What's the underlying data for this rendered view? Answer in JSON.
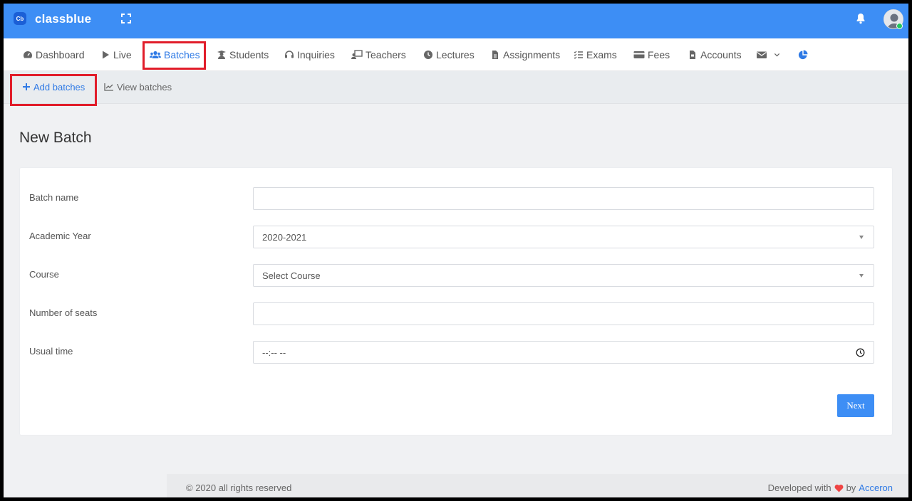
{
  "app": {
    "logo_text": "Cb",
    "brand": "classblue"
  },
  "nav": {
    "items": [
      {
        "label": "Dashboard",
        "icon": "dashboard-icon"
      },
      {
        "label": "Live",
        "icon": "play-icon"
      },
      {
        "label": "Batches",
        "icon": "users-icon",
        "active": true
      },
      {
        "label": "Students",
        "icon": "student-icon"
      },
      {
        "label": "Inquiries",
        "icon": "headset-icon"
      },
      {
        "label": "Teachers",
        "icon": "teacher-icon"
      },
      {
        "label": "Lectures",
        "icon": "clock-icon"
      },
      {
        "label": "Assignments",
        "icon": "file-icon"
      },
      {
        "label": "Exams",
        "icon": "list-check-icon"
      },
      {
        "label": "Fees",
        "icon": "credit-card-icon"
      },
      {
        "label": "Accounts",
        "icon": "file-invoice-icon"
      }
    ]
  },
  "subnav": {
    "add": "Add batches",
    "view": "View batches"
  },
  "page": {
    "title": "New Batch"
  },
  "form": {
    "batch_name": {
      "label": "Batch name",
      "value": "",
      "placeholder": ""
    },
    "academic_year": {
      "label": "Academic Year",
      "value": "2020-2021"
    },
    "course": {
      "label": "Course",
      "value": "Select Course"
    },
    "seats": {
      "label": "Number of seats",
      "value": "",
      "placeholder": ""
    },
    "usual_time": {
      "label": "Usual time",
      "value": "--:-- --"
    },
    "next_label": "Next"
  },
  "footer": {
    "copyright": "© 2020 all rights reserved",
    "developed_with": "Developed with",
    "by": "by",
    "company": "Acceron"
  },
  "colors": {
    "primary": "#3d8ef5",
    "highlight": "#e11d2a",
    "heart": "#ef4444"
  }
}
